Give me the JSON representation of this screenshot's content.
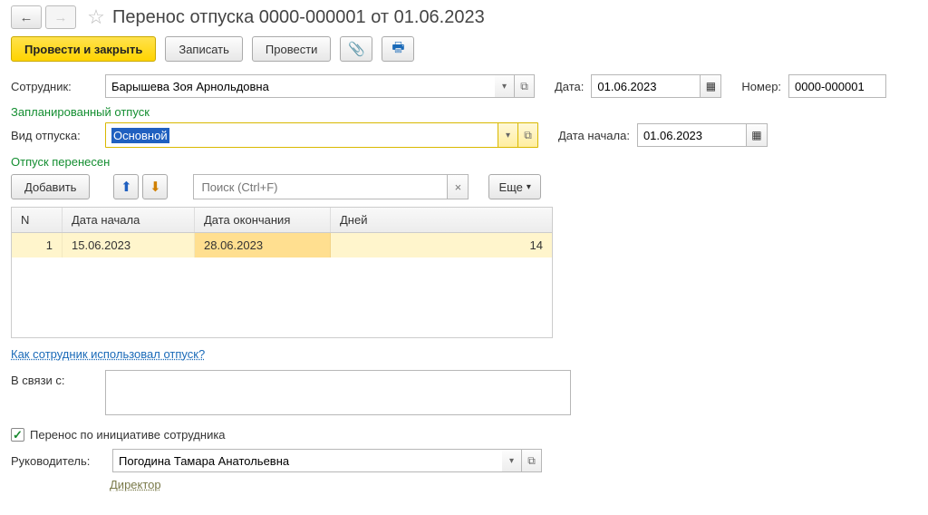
{
  "header": {
    "title": "Перенос отпуска 0000-000001 от 01.06.2023"
  },
  "toolbar": {
    "submit_close": "Провести и закрыть",
    "save": "Записать",
    "submit": "Провести"
  },
  "employee": {
    "label": "Сотрудник:",
    "value": "Барышева Зоя Арнольдовна"
  },
  "date": {
    "label": "Дата:",
    "value": "01.06.2023"
  },
  "number": {
    "label": "Номер:",
    "value": "0000-000001"
  },
  "planned": {
    "section": "Запланированный отпуск",
    "kind_label": "Вид отпуска:",
    "kind_value": "Основной",
    "start_label": "Дата начала:",
    "start_value": "01.06.2023"
  },
  "transferred": {
    "section": "Отпуск перенесен",
    "add": "Добавить",
    "search_placeholder": "Поиск (Ctrl+F)",
    "more": "Еще",
    "columns": {
      "n": "N",
      "start": "Дата начала",
      "end": "Дата окончания",
      "days": "Дней"
    },
    "rows": [
      {
        "n": "1",
        "start": "15.06.2023",
        "end": "28.06.2023",
        "days": "14"
      }
    ]
  },
  "link_usage": "Как сотрудник использовал отпуск?",
  "reason": {
    "label": "В связи с:"
  },
  "initiative": {
    "label": "Перенос по инициативе сотрудника",
    "checked": true
  },
  "manager": {
    "label": "Руководитель:",
    "value": "Погодина Тамара Анатольевна",
    "position": "Директор"
  }
}
